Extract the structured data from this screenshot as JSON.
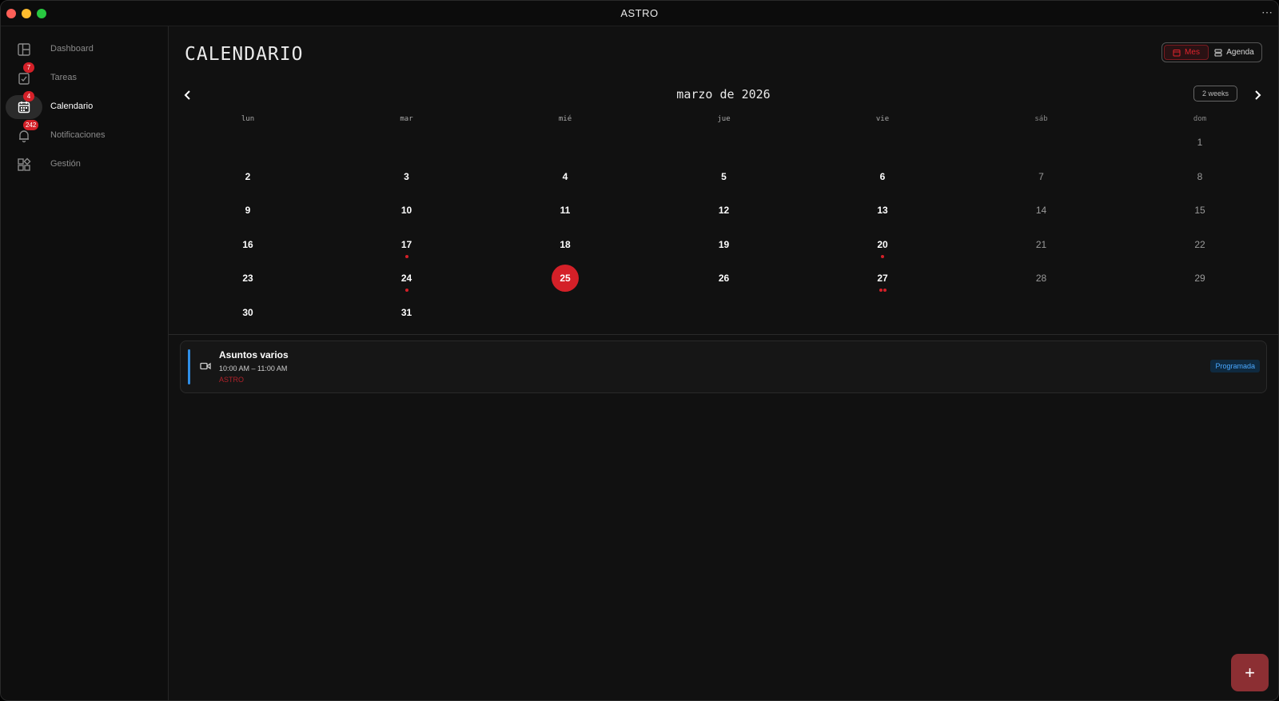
{
  "window": {
    "title": "ASTRO",
    "more_icon": "⋯"
  },
  "sidebar": {
    "items": [
      {
        "label": "Dashboard",
        "icon": "dashboard-icon",
        "badge": null
      },
      {
        "label": "Tareas",
        "icon": "tasks-icon",
        "badge": "7"
      },
      {
        "label": "Calendario",
        "icon": "calendar-icon",
        "badge": "4",
        "active": true
      },
      {
        "label": "Notificaciones",
        "icon": "bell-icon",
        "badge": "242"
      },
      {
        "label": "Gestión",
        "icon": "grid-icon",
        "badge": null
      }
    ]
  },
  "header": {
    "title": "CALENDARIO",
    "view_toggle": {
      "mes": "Mes",
      "agenda": "Agenda",
      "selected": "Mes"
    }
  },
  "calendar": {
    "month_title": "marzo de 2026",
    "prev_icon": "‹",
    "next_icon": "›",
    "range_button": "2 weeks",
    "weekdays": [
      "lun",
      "mar",
      "mié",
      "jue",
      "vie",
      "sáb",
      "dom"
    ],
    "today": 25,
    "weeks": [
      [
        null,
        null,
        null,
        null,
        null,
        null,
        1
      ],
      [
        2,
        3,
        4,
        5,
        6,
        7,
        8
      ],
      [
        9,
        10,
        11,
        12,
        13,
        14,
        15
      ],
      [
        16,
        17,
        18,
        19,
        20,
        21,
        22
      ],
      [
        23,
        24,
        25,
        26,
        27,
        28,
        29
      ],
      [
        30,
        31,
        null,
        null,
        null,
        null,
        null
      ]
    ],
    "event_dots": {
      "17": 1,
      "20": 1,
      "24": 1,
      "25": 1,
      "27": 2
    }
  },
  "events": [
    {
      "title": "Asuntos varios",
      "time": "10:00 AM – 11:00 AM",
      "org": "ASTRO",
      "status": "Programada",
      "icon": "video-icon",
      "accent": "#2f8fe8"
    }
  ],
  "fab": {
    "label": "+"
  },
  "colors": {
    "accent": "#d42028",
    "status_blue": "#4aa8ff"
  }
}
